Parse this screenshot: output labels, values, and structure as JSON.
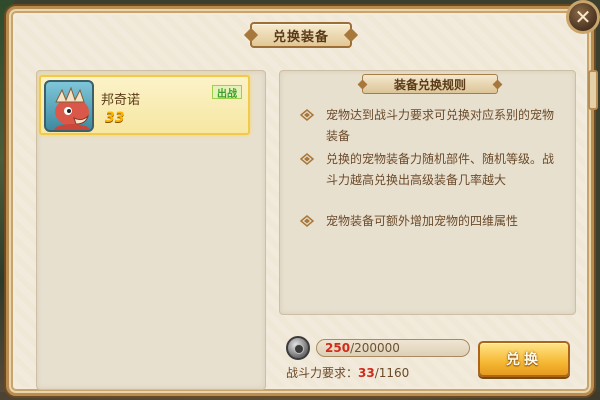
{
  "dialog": {
    "title": "兑换装备",
    "close_glyph": "✕"
  },
  "pet_list": [
    {
      "name": "邦奇诺",
      "level": "33",
      "tag": "出战"
    }
  ],
  "rules": {
    "title": "装备兑换规则",
    "items": [
      "宠物达到战斗力要求可兑换对应系别的宠物装备",
      "兑换的宠物装备力随机部件、随机等级。战斗力越高兑换出高级装备几率越大",
      "宠物装备可额外增加宠物的四维属性"
    ]
  },
  "cost": {
    "current": "250",
    "separator": "/",
    "required": "200000",
    "icon": "coin-icon"
  },
  "power": {
    "label": "战斗力要求：",
    "current": "33",
    "separator": "/",
    "required": "1160"
  },
  "exchange_button_label": "兑换",
  "colors": {
    "accent_gold": "#f5b834",
    "highlight_red": "#d02a1a",
    "text_brown": "#6b4a2a",
    "panel_bg": "#e8e0cf"
  }
}
